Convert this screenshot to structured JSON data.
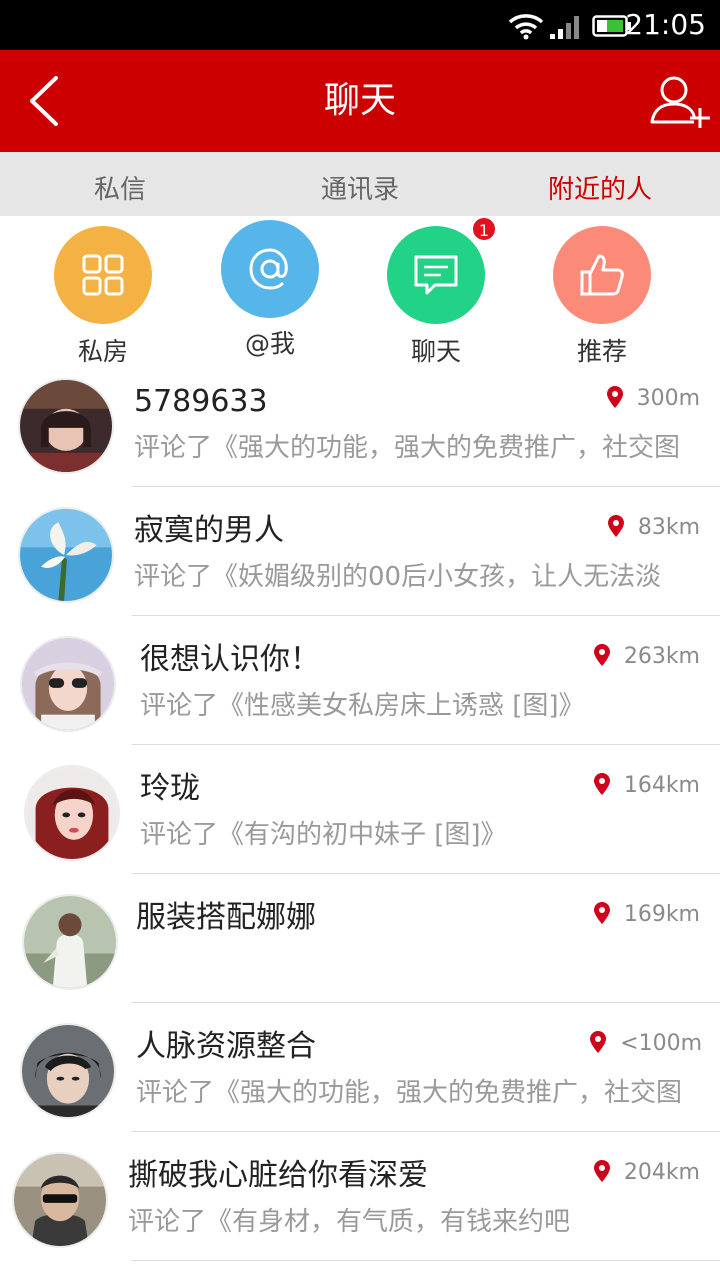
{
  "status_bar": {
    "time": "21:05",
    "wifi_icon": "wifi-icon",
    "signal_icon": "signal-icon",
    "battery_icon": "battery-icon"
  },
  "header": {
    "title": "聊天",
    "back_icon": "back-arrow-icon",
    "add_icon": "add-user-icon",
    "bg_color": "#cc0000"
  },
  "tabs": [
    {
      "label": "私信",
      "active": false
    },
    {
      "label": "通讯录",
      "active": false
    },
    {
      "label": "附近的人",
      "active": true
    }
  ],
  "quick_actions": [
    {
      "label": "私房",
      "icon": "grid-icon",
      "color": "#f5b244"
    },
    {
      "label": "@我",
      "icon": "at-icon",
      "color": "#56b6ea"
    },
    {
      "label": "聊天",
      "icon": "chat-icon",
      "color": "#22d387",
      "badge": "1"
    },
    {
      "label": "推荐",
      "icon": "thumbs-up-icon",
      "color": "#fb8a78"
    }
  ],
  "people": [
    {
      "name": "5789633",
      "comment": "评论了《强大的功能，强大的免费推广，社交图",
      "distance": "300m"
    },
    {
      "name": "寂寞的男人",
      "comment": "评论了《妖媚级别的00后小女孩，让人无法淡",
      "distance": "83km"
    },
    {
      "name": "很想认识你！",
      "comment": "评论了《性感美女私房床上诱惑 [图]》",
      "distance": "263km"
    },
    {
      "name": "玲珑",
      "comment": "评论了《有沟的初中妹子 [图]》",
      "distance": "164km"
    },
    {
      "name": "服装搭配娜娜",
      "comment": "",
      "distance": "169km"
    },
    {
      "name": "人脉资源整合",
      "comment": "评论了《强大的功能，强大的免费推广，社交图",
      "distance": "<100m"
    },
    {
      "name": "撕破我心脏给你看深爱",
      "comment": "评论了《有身材，有气质，有钱来约吧",
      "distance": "204km"
    }
  ]
}
